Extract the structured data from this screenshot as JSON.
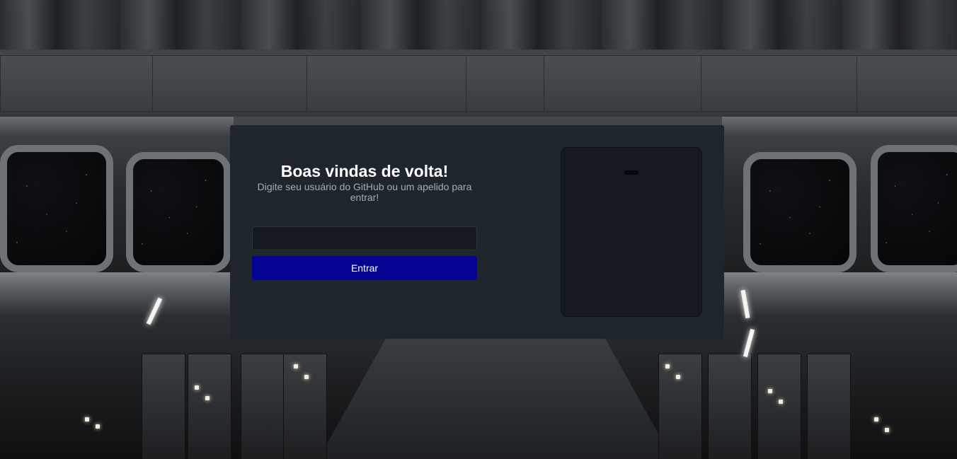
{
  "login": {
    "title": "Boas vindas de volta!",
    "subtitle": "Digite seu usuário do GitHub ou um apelido para entrar!",
    "input_value": "",
    "input_placeholder": "",
    "submit_label": "Entrar"
  },
  "colors": {
    "card_background": "#1e252d",
    "button_primary": "#030391",
    "input_background": "#141a20",
    "subtitle_text": "#a3acb7"
  }
}
